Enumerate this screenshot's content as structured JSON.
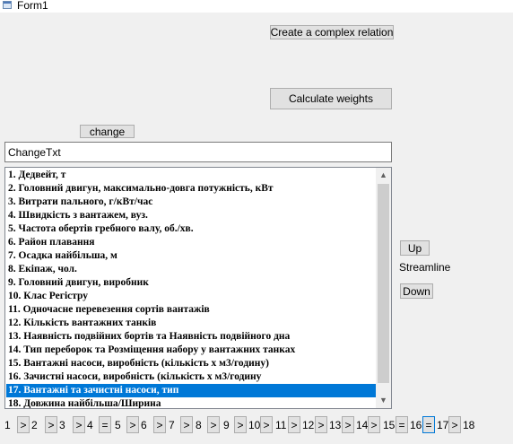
{
  "window": {
    "title": "Form1"
  },
  "buttons": {
    "create_complex_relation": "Create a complex relation",
    "calculate_weights": "Calculate weights",
    "change": "change",
    "up": "Up",
    "down": "Down"
  },
  "change_text": {
    "value": "ChangeTxt"
  },
  "streamline_label": "Streamline",
  "list": {
    "selected_index": 16,
    "items": [
      "1. Дедвейт, т",
      "2. Головний двигун, максимально-довга потужність, кВт",
      "3. Витрати пального, г/кВт/час",
      "4. Швидкість з вантажем, вуз.",
      "5. Частота обертів гребного валу, об./хв.",
      "6. Район плавання",
      "7. Осадка найбільша, м",
      "8. Екіпаж, чол.",
      "9. Головний двигун, виробник",
      "10. Клас Регістру",
      "11. Одночасне перевезення сортів вантажів",
      "12. Кількість вантажних танків",
      "13. Наявність подвійних бортів та Наявність подвійного дна",
      "14. Тип  переборок та Розміщення набору у вантажних танках",
      "15. Вантажні насоси, виробність (кількість х м3/годину)",
      "16. Зачистні насоси, виробність (кількість х м3/годину",
      "17. Вантажні та зачистні насоси, тип",
      "18. Довжина найбільша/Ширина"
    ]
  },
  "pager": {
    "numbers": [
      "1",
      "2",
      "3",
      "4",
      "5",
      "6",
      "7",
      "8",
      "9",
      "10",
      "11",
      "12",
      "13",
      "14",
      "15",
      "16",
      "17",
      "18"
    ],
    "buttons": [
      ">",
      ">",
      ">",
      "=",
      ">",
      ">",
      ">",
      ">",
      ">",
      ">",
      ">",
      ">",
      ">",
      ">",
      "=",
      "=",
      ">"
    ]
  }
}
